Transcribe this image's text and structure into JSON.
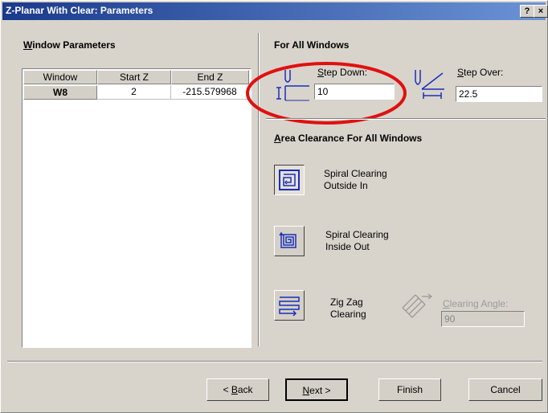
{
  "window": {
    "title": "Z-Planar With Clear: Parameters",
    "help_label": "?",
    "close_label": "×"
  },
  "left": {
    "heading": "Window Parameters",
    "heading_underline": "W",
    "heading_rest": "indow Parameters",
    "columns": [
      "Window",
      "Start Z",
      "End Z"
    ],
    "rows": [
      {
        "window": "W8",
        "start_z": "2",
        "end_z": "-215.579968"
      }
    ]
  },
  "right": {
    "heading": "For All Windows",
    "step_down": {
      "label_u": "S",
      "label_rest": "tep Down:",
      "value": "10"
    },
    "step_over": {
      "label_u": "S",
      "label_rest": "tep Over:",
      "value": "22.5"
    },
    "area_heading_u": "A",
    "area_heading_rest": "rea Clearance For All Windows",
    "options": {
      "spiral_out_in": {
        "line1": "Spiral Clearing",
        "line2": "Outside In",
        "selected": true
      },
      "spiral_in_out": {
        "line1": "Spiral Clearing",
        "line2": "Inside Out",
        "selected": false
      },
      "zigzag": {
        "line1": "Zig Zag",
        "line2": "Clearing",
        "selected": false
      }
    },
    "clearing_angle": {
      "label_u": "C",
      "label_rest": "learing Angle:",
      "value": "90",
      "enabled": false
    }
  },
  "buttons": {
    "back_prefix": "< ",
    "back_u": "B",
    "back_rest": "ack",
    "next_u": "N",
    "next_rest": "ext >",
    "finish": "Finish",
    "cancel": "Cancel"
  },
  "colors": {
    "highlight_ring": "#e01010",
    "icon_blue": "#1a2fb8",
    "title_bar_start": "#1a3a8c"
  }
}
